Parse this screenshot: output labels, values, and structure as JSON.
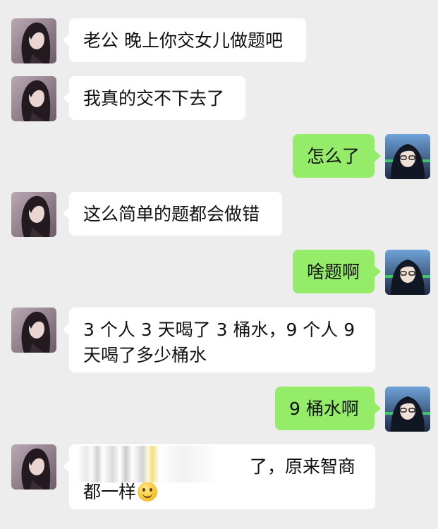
{
  "messages": [
    {
      "side": "left",
      "text": "老公 晚上你交女儿做题吧"
    },
    {
      "side": "left",
      "text": "我真的交不下去了"
    },
    {
      "side": "right",
      "text": "怎么了"
    },
    {
      "side": "left",
      "text": "这么简单的题都会做错"
    },
    {
      "side": "right",
      "text": "啥题啊"
    },
    {
      "side": "left",
      "line1": "3 个人 3 天喝了 3 桶水，9 个人 9",
      "line2": "天喝了多少桶水"
    },
    {
      "side": "right",
      "text": "9 桶水啊"
    },
    {
      "side": "left",
      "line1": "了，原来智商",
      "line2": "都一样"
    }
  ],
  "icons": {
    "left_avatar": "woman-avatar-icon",
    "right_avatar": "hooded-man-avatar-icon",
    "emoji": "smiley-emoji-icon"
  },
  "colors": {
    "background": "#ededed",
    "incoming_bubble": "#ffffff",
    "outgoing_bubble": "#95ec69"
  }
}
